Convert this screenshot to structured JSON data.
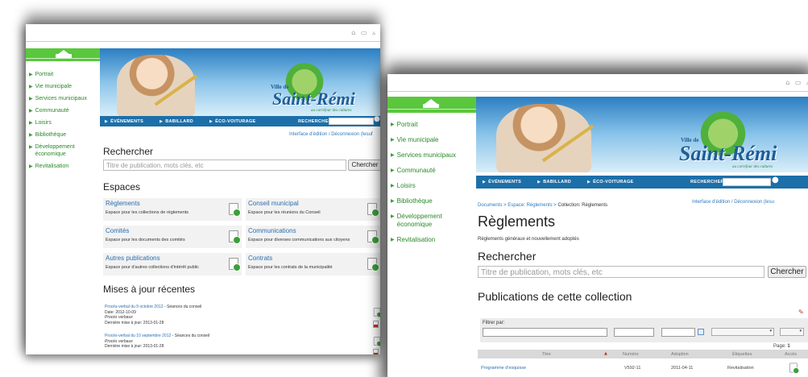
{
  "topbar_icons": "⌂ ▭ ▵",
  "site": {
    "brand_prefix": "Ville de",
    "brand": "Saint-Rémi",
    "tagline": "au carrefour des cultures"
  },
  "sidebar": {
    "items": [
      {
        "label": "Portrait"
      },
      {
        "label": "Vie municipale"
      },
      {
        "label": "Services municipaux"
      },
      {
        "label": "Communauté"
      },
      {
        "label": "Loisirs"
      },
      {
        "label": "Bibliothèque"
      },
      {
        "label": "Développement économique"
      },
      {
        "label": "Revitalisation"
      }
    ]
  },
  "nav": {
    "items": [
      {
        "label": "ÉVÉNEMENTS"
      },
      {
        "label": "BABILLARD"
      },
      {
        "label": "ÉCO-VOITURAGE"
      }
    ],
    "search_label": "RECHERCHER"
  },
  "edit_links": {
    "edit": "Interface d'édition",
    "sep": "/",
    "logout": "Déconnexion (lesuf",
    "logout2": "Déconnexion (lesu"
  },
  "home": {
    "search_title": "Rechercher",
    "search_placeholder": "Titre de publication, mots clés, etc",
    "search_button": "Chercher",
    "spaces_title": "Espaces",
    "spaces": [
      {
        "title": "Règlements",
        "desc": "Espace pour les collections de règlements"
      },
      {
        "title": "Conseil municipal",
        "desc": "Espace pour les réunions du Conseil"
      },
      {
        "title": "Comités",
        "desc": "Espace pour les documents des comités"
      },
      {
        "title": "Communications",
        "desc": "Espace pour diverses communications aux citoyens"
      },
      {
        "title": "Autres publications",
        "desc": "Espace pour d'autres collections d'intérêt public"
      },
      {
        "title": "Contrats",
        "desc": "Espace pour les contrats de la municipalité"
      }
    ],
    "updates_title": "Mises à jour récentes",
    "updates": [
      {
        "link": "Procès-verbal du 9 octobre 2012",
        "sep": " - ",
        "section": "Séances du conseil",
        "date": "Date: 2012-10-09",
        "type": "Procès verbaux",
        "modified": "Dernière mise à jour: 2013-01-28"
      },
      {
        "link": "Procès-verbal du 10 septembre 2012",
        "sep": " - ",
        "section": "Séances du conseil",
        "type": "Procès verbaux",
        "modified": "Dernière mise à jour: 2013-01-28"
      }
    ]
  },
  "collection": {
    "breadcrumb": [
      "Documents",
      "Espace: Règlements",
      "Collection: Règlements"
    ],
    "crumb_sep": ">",
    "title": "Règlements",
    "subtitle": "Règlements généraux et nouvellement adoptés",
    "search_title": "Rechercher",
    "search_placeholder": "Titre de publication, mots clés, etc",
    "search_button": "Chercher",
    "pubs_title": "Publications de cette collection",
    "filter_label": "Filtrer par:",
    "page_label": "Page:",
    "page_value": "1",
    "columns": [
      "Titre",
      "Numéro",
      "Adoption",
      "Étiquettes",
      "Accès"
    ],
    "rows": [
      {
        "title": "Programme d'esquisse",
        "numero": "V592-11",
        "adoption": "2011-04-11",
        "etiquettes": "Revitalisation"
      }
    ]
  }
}
